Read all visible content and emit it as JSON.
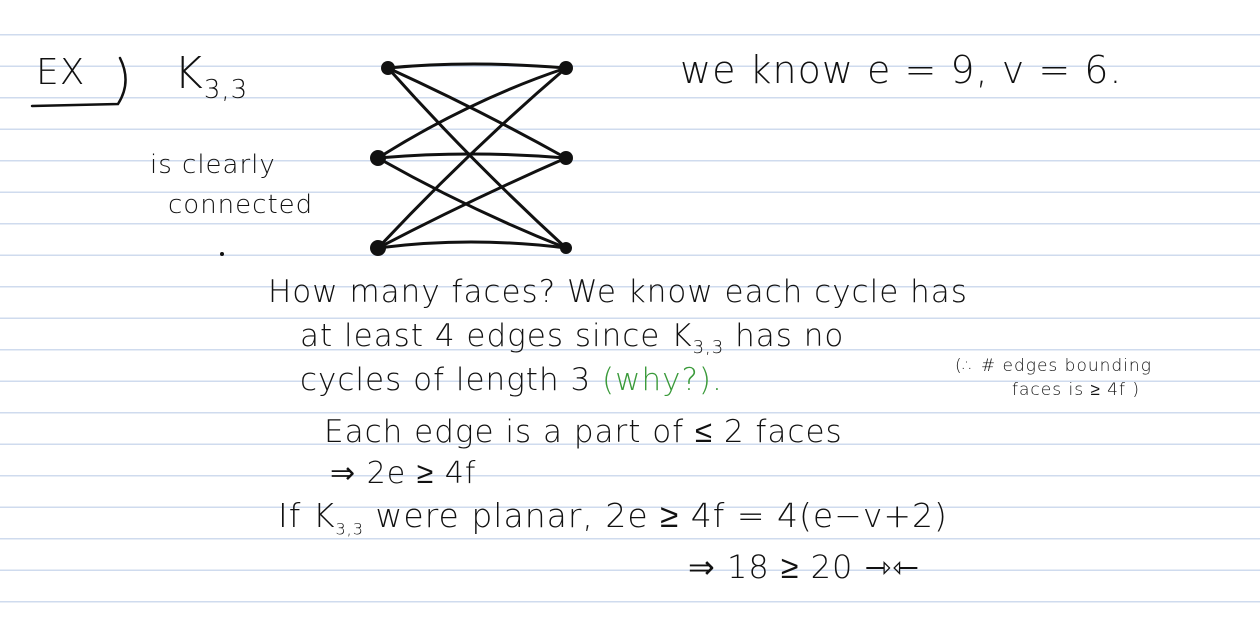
{
  "notes": {
    "example_label": "EX",
    "graph_name": "K",
    "graph_subscript": "3,3",
    "clearly": "is clearly",
    "connected": "connected",
    "we_know": "we know e = 9, v = 6.",
    "line1": "How many faces?  We know each cycle has",
    "line2a": "at least 4 edges since K",
    "line2_sub": "3,3",
    "line2b": " has no",
    "line3a": "cycles of length 3",
    "line3_green": " (why?)",
    "line3_dot": ".",
    "side_note_1": "(∴ # edges bounding",
    "side_note_2": "faces is ≥ 4f )",
    "line4": "Each edge is a part of  ≤ 2  faces",
    "line5": "⇒   2e ≥ 4f",
    "line6a": "If  K",
    "line6_sub": "3,3",
    "line6b": " were planar,  2e ≥ 4f = 4(e−v+2)",
    "line7": "⇒ 18  ≥ 20   ⇾⇽"
  },
  "colors": {
    "ink": "#111111",
    "green": "#3a9a3a",
    "rule": "#cfdbee"
  }
}
